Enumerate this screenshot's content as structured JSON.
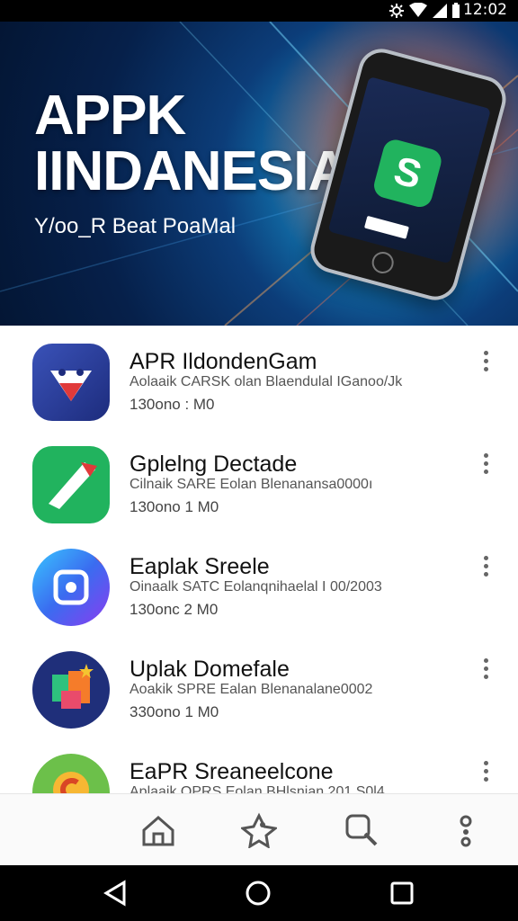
{
  "status_bar": {
    "time": "12:02",
    "icons": [
      "settings-icon",
      "wifi-icon",
      "signal-icon",
      "battery-icon"
    ]
  },
  "hero": {
    "title_line1": "APPK",
    "title_line2": "IINDANESIA",
    "subtitle": "Y/oo_R Beat PoaMal"
  },
  "apps": [
    {
      "name": "APR IldondenGam",
      "desc": "Aolaaik CARSK olan Blaendulal IGanoo/Jk",
      "meta": "130ono : M0",
      "icon": "android-face-icon"
    },
    {
      "name": "Gplelng Dectade",
      "desc": "Cilnaik SARE Eolan Blenanansa0000ı",
      "meta": "130ono 1 M0",
      "icon": "green-arrow-icon"
    },
    {
      "name": "Eaplak Sreele",
      "desc": "Oinaalk SATC Eolanqnihaelal I 00/2003",
      "meta": "130onc 2 M0",
      "icon": "camera-square-icon"
    },
    {
      "name": "Uplak Domefale",
      "desc": "Aoakik SPRE Ealan Blenanalane0002",
      "meta": "330ono 1 M0",
      "icon": "colorful-tiles-icon"
    },
    {
      "name": "EaPR Sreaneelcone",
      "desc": "Aplaaik OPRS Eolan BHlsnian 201 S0l4",
      "meta": "",
      "icon": "sun-c-icon"
    }
  ],
  "bottom_nav": [
    "home-icon",
    "rocket-icon",
    "search-icon",
    "profile-icon"
  ],
  "colors": {
    "hero_dark": "#06204a",
    "accent_green": "#21b35e",
    "nav_bg": "#fafafa"
  }
}
